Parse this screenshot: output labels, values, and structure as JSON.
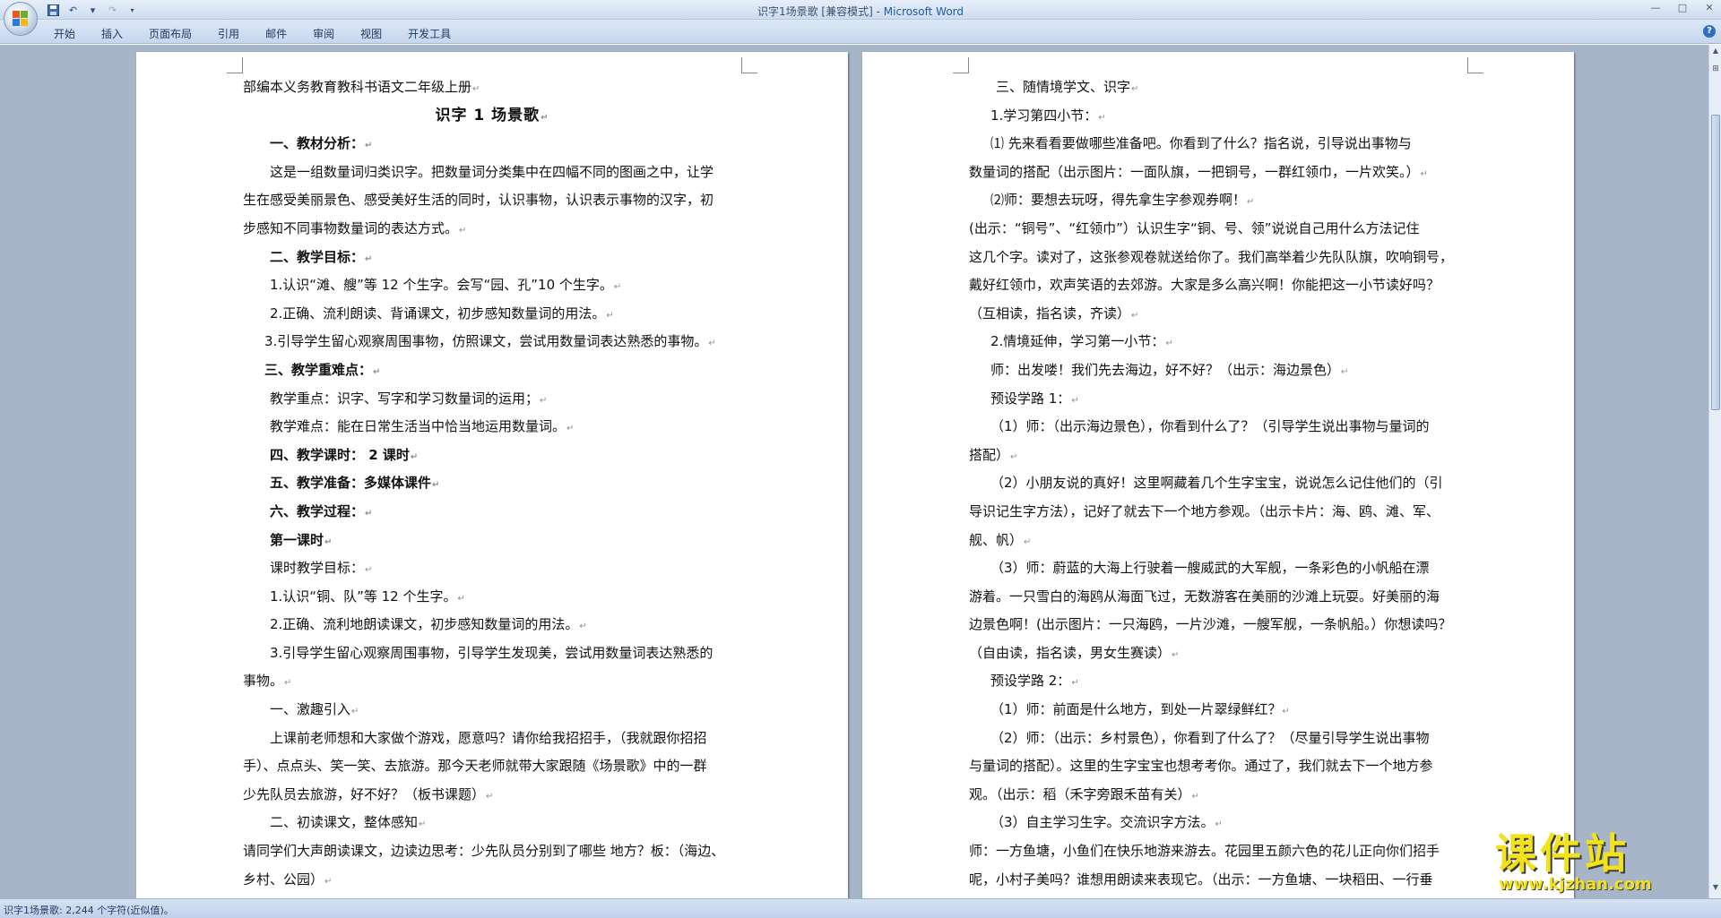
{
  "window": {
    "title_doc": "识字1场景歌 [兼容模式] - ",
    "title_app": "Microsoft Word",
    "minimize": "—",
    "maximize": "□",
    "close": "✕"
  },
  "quick_access": {
    "save_icon": "save-icon",
    "undo_icon": "undo-icon",
    "redo_icon": "redo-icon",
    "customize_icon": "chevron-down-icon"
  },
  "ribbon": {
    "tabs": [
      "开始",
      "插入",
      "页面布局",
      "引用",
      "邮件",
      "审阅",
      "视图",
      "开发工具"
    ],
    "help": "?"
  },
  "paragraph_mark": "↵",
  "document": {
    "left_page": [
      {
        "text": "部编本义务教育教科书语文二年级上册",
        "style": "normal",
        "indent": 0
      },
      {
        "text": "识字 1  场景歌",
        "style": "title",
        "indent": 0
      },
      {
        "text": "一、教材分析：",
        "style": "bold",
        "indent": 2
      },
      {
        "text": "这是一组数量词归类识字。把数量词分类集中在四幅不同的图画之中，让学",
        "style": "normal",
        "indent": 2,
        "nomark": true
      },
      {
        "text": "生在感受美丽景色、感受美好生活的同时，认识事物，认识表示事物的汉字，初",
        "style": "normal",
        "indent": 0,
        "nomark": true
      },
      {
        "text": "步感知不同事物数量词的表达方式。",
        "style": "normal",
        "indent": 0
      },
      {
        "text": "二、教学目标：",
        "style": "bold",
        "indent": 2
      },
      {
        "text": "1.认识“滩、艘”等 12 个生字。会写“园、孔”10 个生字。",
        "style": "normal",
        "indent": 2
      },
      {
        "text": "2.正确、流利朗读、背诵课文，初步感知数量词的用法。",
        "style": "normal",
        "indent": 2
      },
      {
        "text": "3.引导学生留心观察周围事物，仿照课文，尝试用数量词表达熟悉的事物。",
        "style": "normal",
        "indent": 1.6
      },
      {
        "text": "三、教学重难点：",
        "style": "bold",
        "indent": 1.6
      },
      {
        "text": "教学重点：识字、写字和学习数量词的运用；",
        "style": "normal",
        "indent": 2
      },
      {
        "text": "教学难点：能在日常生活当中恰当地运用数量词。",
        "style": "normal",
        "indent": 2
      },
      {
        "text": "四、教学课时： 2 课时",
        "style": "bold",
        "indent": 2
      },
      {
        "text": "五、教学准备：多媒体课件",
        "style": "bold",
        "indent": 2
      },
      {
        "text": "六、教学过程：",
        "style": "bold",
        "indent": 2
      },
      {
        "text": "第一课时",
        "style": "bold",
        "indent": 2
      },
      {
        "text": "课时教学目标：",
        "style": "normal",
        "indent": 2
      },
      {
        "text": "1.认识“铜、队”等 12 个生字。",
        "style": "normal",
        "indent": 2
      },
      {
        "text": "2.正确、流利地朗读课文，初步感知数量词的用法。",
        "style": "normal",
        "indent": 2
      },
      {
        "text": "3.引导学生留心观察周围事物，引导学生发现美，尝试用数量词表达熟悉的",
        "style": "normal",
        "indent": 2,
        "nomark": true
      },
      {
        "text": "事物。",
        "style": "normal",
        "indent": 0
      },
      {
        "text": "一、激趣引入",
        "style": "normal",
        "indent": 2
      },
      {
        "text": "上课前老师想和大家做个游戏，愿意吗？请你给我招招手，（我就跟你招招",
        "style": "normal",
        "indent": 2,
        "nomark": true
      },
      {
        "text": "手）、点点头、笑一笑、去旅游。那今天老师就带大家跟随《场景歌》中的一群",
        "style": "normal",
        "indent": 0,
        "nomark": true
      },
      {
        "text": "少先队员去旅游，好不好？（板书课题）",
        "style": "normal",
        "indent": 0
      },
      {
        "text": "二、初读课文，整体感知",
        "style": "normal",
        "indent": 2
      },
      {
        "text": "请同学们大声朗读课文，边读边思考：少先队员分别到了哪些 地方？板：（海边、",
        "style": "normal",
        "indent": 0,
        "nomark": true
      },
      {
        "text": "乡村、公园）",
        "style": "normal",
        "indent": 0
      }
    ],
    "right_page": [
      {
        "text": "三、随情境学文、识字",
        "style": "normal",
        "indent": 2
      },
      {
        "text": "1.学习第四小节：",
        "style": "normal",
        "indent": 1.6
      },
      {
        "text": "⑴ 先来看看要做哪些准备吧。你看到了什么？指名说，引导说出事物与",
        "style": "normal",
        "indent": 1.6,
        "nomark": true
      },
      {
        "text": "数量词的搭配（出示图片：一面队旗，一把铜号，一群红领巾，一片欢笑。）",
        "style": "normal",
        "indent": 0
      },
      {
        "text": "⑵师：要想去玩呀，得先拿生字参观券啊！",
        "style": "normal",
        "indent": 1.6
      },
      {
        "text": "(出示：“铜号”、“红领巾”）认识生字“铜、号、领”说说自己用什么方法记住",
        "style": "normal",
        "indent": 0,
        "nomark": true
      },
      {
        "text": "这几个字。读对了，这张参观卷就送给你了。我们高举着少先队队旗，吹响铜号，",
        "style": "normal",
        "indent": 0,
        "nomark": true
      },
      {
        "text": "戴好红领巾，欢声笑语的去郊游。大家是多么高兴啊！你能把这一小节读好吗？",
        "style": "normal",
        "indent": 0,
        "nomark": true
      },
      {
        "text": "（互相读，指名读，齐读）",
        "style": "normal",
        "indent": 0
      },
      {
        "text": "2.情境延伸，学习第一小节：",
        "style": "normal",
        "indent": 1.6
      },
      {
        "text": "师：出发喽！我们先去海边，好不好？（出示：海边景色）",
        "style": "normal",
        "indent": 1.6
      },
      {
        "text": "预设学路 1：",
        "style": "normal",
        "indent": 1.6
      },
      {
        "text": "（1）师：（出示海边景色），你看到什么了？（引导学生说出事物与量词的",
        "style": "normal",
        "indent": 1.6,
        "nomark": true
      },
      {
        "text": "搭配）",
        "style": "normal",
        "indent": 0
      },
      {
        "text": "（2）小朋友说的真好！这里啊藏着几个生字宝宝，说说怎么记住他们的（引",
        "style": "normal",
        "indent": 1.6,
        "nomark": true
      },
      {
        "text": "导识记生字方法），记好了就去下一个地方参观。（出示卡片：海、鸥、滩、军、",
        "style": "normal",
        "indent": 0,
        "nomark": true
      },
      {
        "text": "舰、帆）",
        "style": "normal",
        "indent": 0
      },
      {
        "text": "（3）师：蔚蓝的大海上行驶着一艘威武的大军舰，一条彩色的小帆船在漂",
        "style": "normal",
        "indent": 1.6,
        "nomark": true
      },
      {
        "text": "游着。一只雪白的海鸥从海面飞过，无数游客在美丽的沙滩上玩耍。好美丽的海",
        "style": "normal",
        "indent": 0,
        "nomark": true
      },
      {
        "text": "边景色啊！(出示图片：一只海鸥，一片沙滩，一艘军舰，一条帆船。）你想读吗？",
        "style": "normal",
        "indent": 0,
        "nomark": true
      },
      {
        "text": "（自由读，指名读，男女生赛读）",
        "style": "normal",
        "indent": 0
      },
      {
        "text": "预设学路 2：",
        "style": "normal",
        "indent": 1.6
      },
      {
        "text": "（1）师：前面是什么地方，到处一片翠绿鲜红？",
        "style": "normal",
        "indent": 1.6
      },
      {
        "text": "（2）师：（出示：乡村景色），你看到了什么了？（尽量引导学生说出事物",
        "style": "normal",
        "indent": 1.6,
        "nomark": true
      },
      {
        "text": "与量词的搭配）。这里的生字宝宝也想考考你。通过了，我们就去下一个地方参",
        "style": "normal",
        "indent": 0,
        "nomark": true
      },
      {
        "text": "观。（出示：稻（禾字旁跟禾苗有关）",
        "style": "normal",
        "indent": 0
      },
      {
        "text": "（3）自主学习生字。交流识字方法。",
        "style": "normal",
        "indent": 1.6
      },
      {
        "text": "师：一方鱼塘，小鱼们在快乐地游来游去。花园里五颜六色的花儿正向你们招手",
        "style": "normal",
        "indent": 0,
        "nomark": true
      },
      {
        "text": "呢，小村子美吗？谁想用朗读来表现它。（出示：一方鱼塘、一块稻田、一行垂",
        "style": "normal",
        "indent": 0,
        "nomark": true
      }
    ]
  },
  "statusbar": {
    "text": "识字1场景歌: 2,244 个字符(近似值)。"
  },
  "watermark": {
    "cn": "课件站",
    "url": "www.kjzhan.com"
  }
}
